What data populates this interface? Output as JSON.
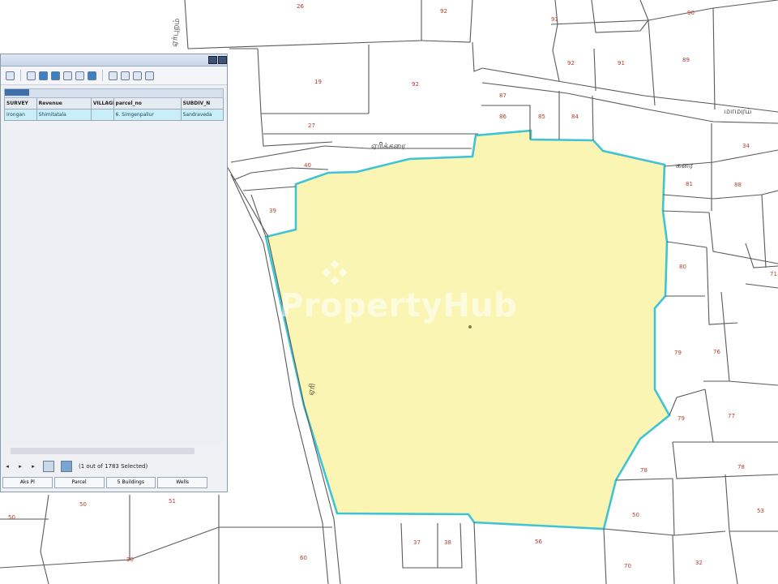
{
  "map": {
    "watermark": "PropertyHub",
    "road_labels": [
      {
        "id": "top-left-vertical",
        "text": "ஏர்புறம்"
      },
      {
        "id": "north-road",
        "text": "ஏரிக்கரை"
      },
      {
        "id": "east-road",
        "text": "கரை"
      },
      {
        "id": "west-road",
        "text": "ஏரி"
      },
      {
        "id": "far-east-road",
        "text": "மாமரம்"
      }
    ],
    "colors": {
      "highlight_fill": "#fbf5b3",
      "highlight_stroke": "#3fc3d6",
      "parcel_line": "#5a5a5a",
      "parcel_number": "#c0392b"
    }
  },
  "attribute_table": {
    "columns": [
      "SURVEY",
      "Revenue",
      "VILLAGE",
      "parcel_no",
      "SUBDIV_N"
    ],
    "selected_row": [
      "Irongan",
      "Shimitatala",
      "",
      "6. Simgenpallur",
      "Sandraveda"
    ],
    "status": "(1 out of 1783 Selected)",
    "tabs": [
      "Aks Pl",
      "Parcel",
      "5 Buildings",
      "Wells"
    ]
  }
}
